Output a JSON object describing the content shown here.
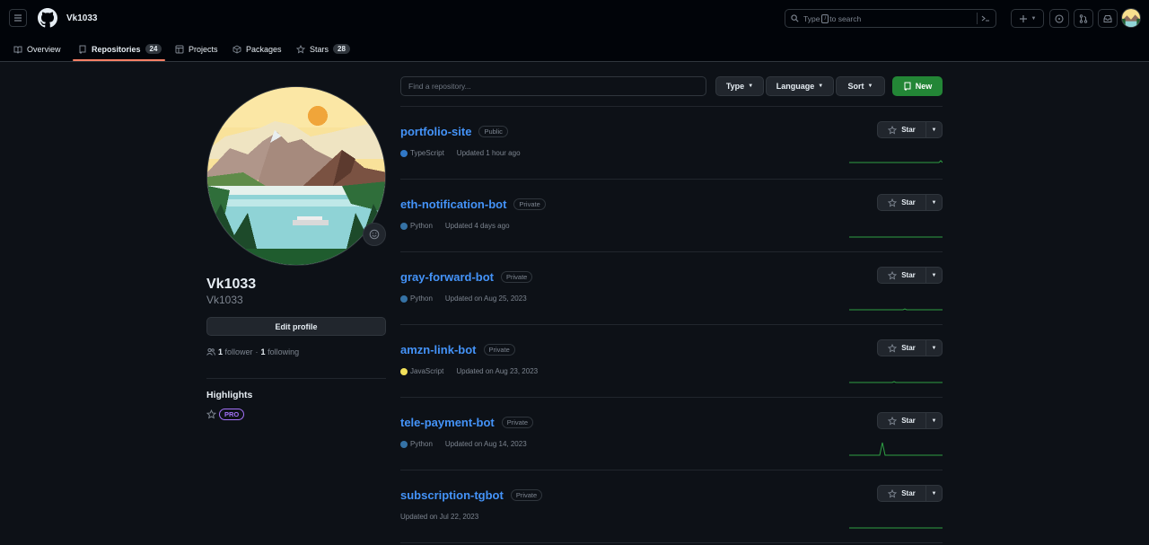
{
  "header": {
    "username": "Vk1033",
    "search_prefix": "Type",
    "search_key": "/",
    "search_suffix": "to search"
  },
  "tabs": [
    {
      "label": "Overview",
      "count": null
    },
    {
      "label": "Repositories",
      "count": "24"
    },
    {
      "label": "Projects",
      "count": null
    },
    {
      "label": "Packages",
      "count": null
    },
    {
      "label": "Stars",
      "count": "28"
    }
  ],
  "profile": {
    "display_name": "Vk1033",
    "login": "Vk1033",
    "edit_label": "Edit profile",
    "followers_count": "1",
    "followers_label": "follower",
    "separator": "·",
    "following_count": "1",
    "following_label": "following",
    "highlights_title": "Highlights",
    "pro_label": "PRO"
  },
  "filters": {
    "search_placeholder": "Find a repository...",
    "type_label": "Type",
    "language_label": "Language",
    "sort_label": "Sort",
    "new_label": "New"
  },
  "star_label": "Star",
  "colors": {
    "accent_link": "#4493f8",
    "new_button": "#238636",
    "active_tab_underline": "#f78166",
    "typescript": "#3178c6",
    "python": "#3572A5",
    "javascript": "#f1e05a",
    "pro": "#a371f7",
    "sparkline": "#2ea043"
  },
  "repos": [
    {
      "name": "portfolio-site",
      "visibility": "Public",
      "language": "TypeScript",
      "lang_color": "#3178c6",
      "updated": "Updated 1 hour ago"
    },
    {
      "name": "eth-notification-bot",
      "visibility": "Private",
      "language": "Python",
      "lang_color": "#3572A5",
      "updated": "Updated 4 days ago"
    },
    {
      "name": "gray-forward-bot",
      "visibility": "Private",
      "language": "Python",
      "lang_color": "#3572A5",
      "updated": "Updated on Aug 25, 2023"
    },
    {
      "name": "amzn-link-bot",
      "visibility": "Private",
      "language": "JavaScript",
      "lang_color": "#f1e05a",
      "updated": "Updated on Aug 23, 2023"
    },
    {
      "name": "tele-payment-bot",
      "visibility": "Private",
      "language": "Python",
      "lang_color": "#3572A5",
      "updated": "Updated on Aug 14, 2023"
    },
    {
      "name": "subscription-tgbot",
      "visibility": "Private",
      "language": "",
      "lang_color": "",
      "updated": "Updated on Jul 22, 2023"
    }
  ]
}
